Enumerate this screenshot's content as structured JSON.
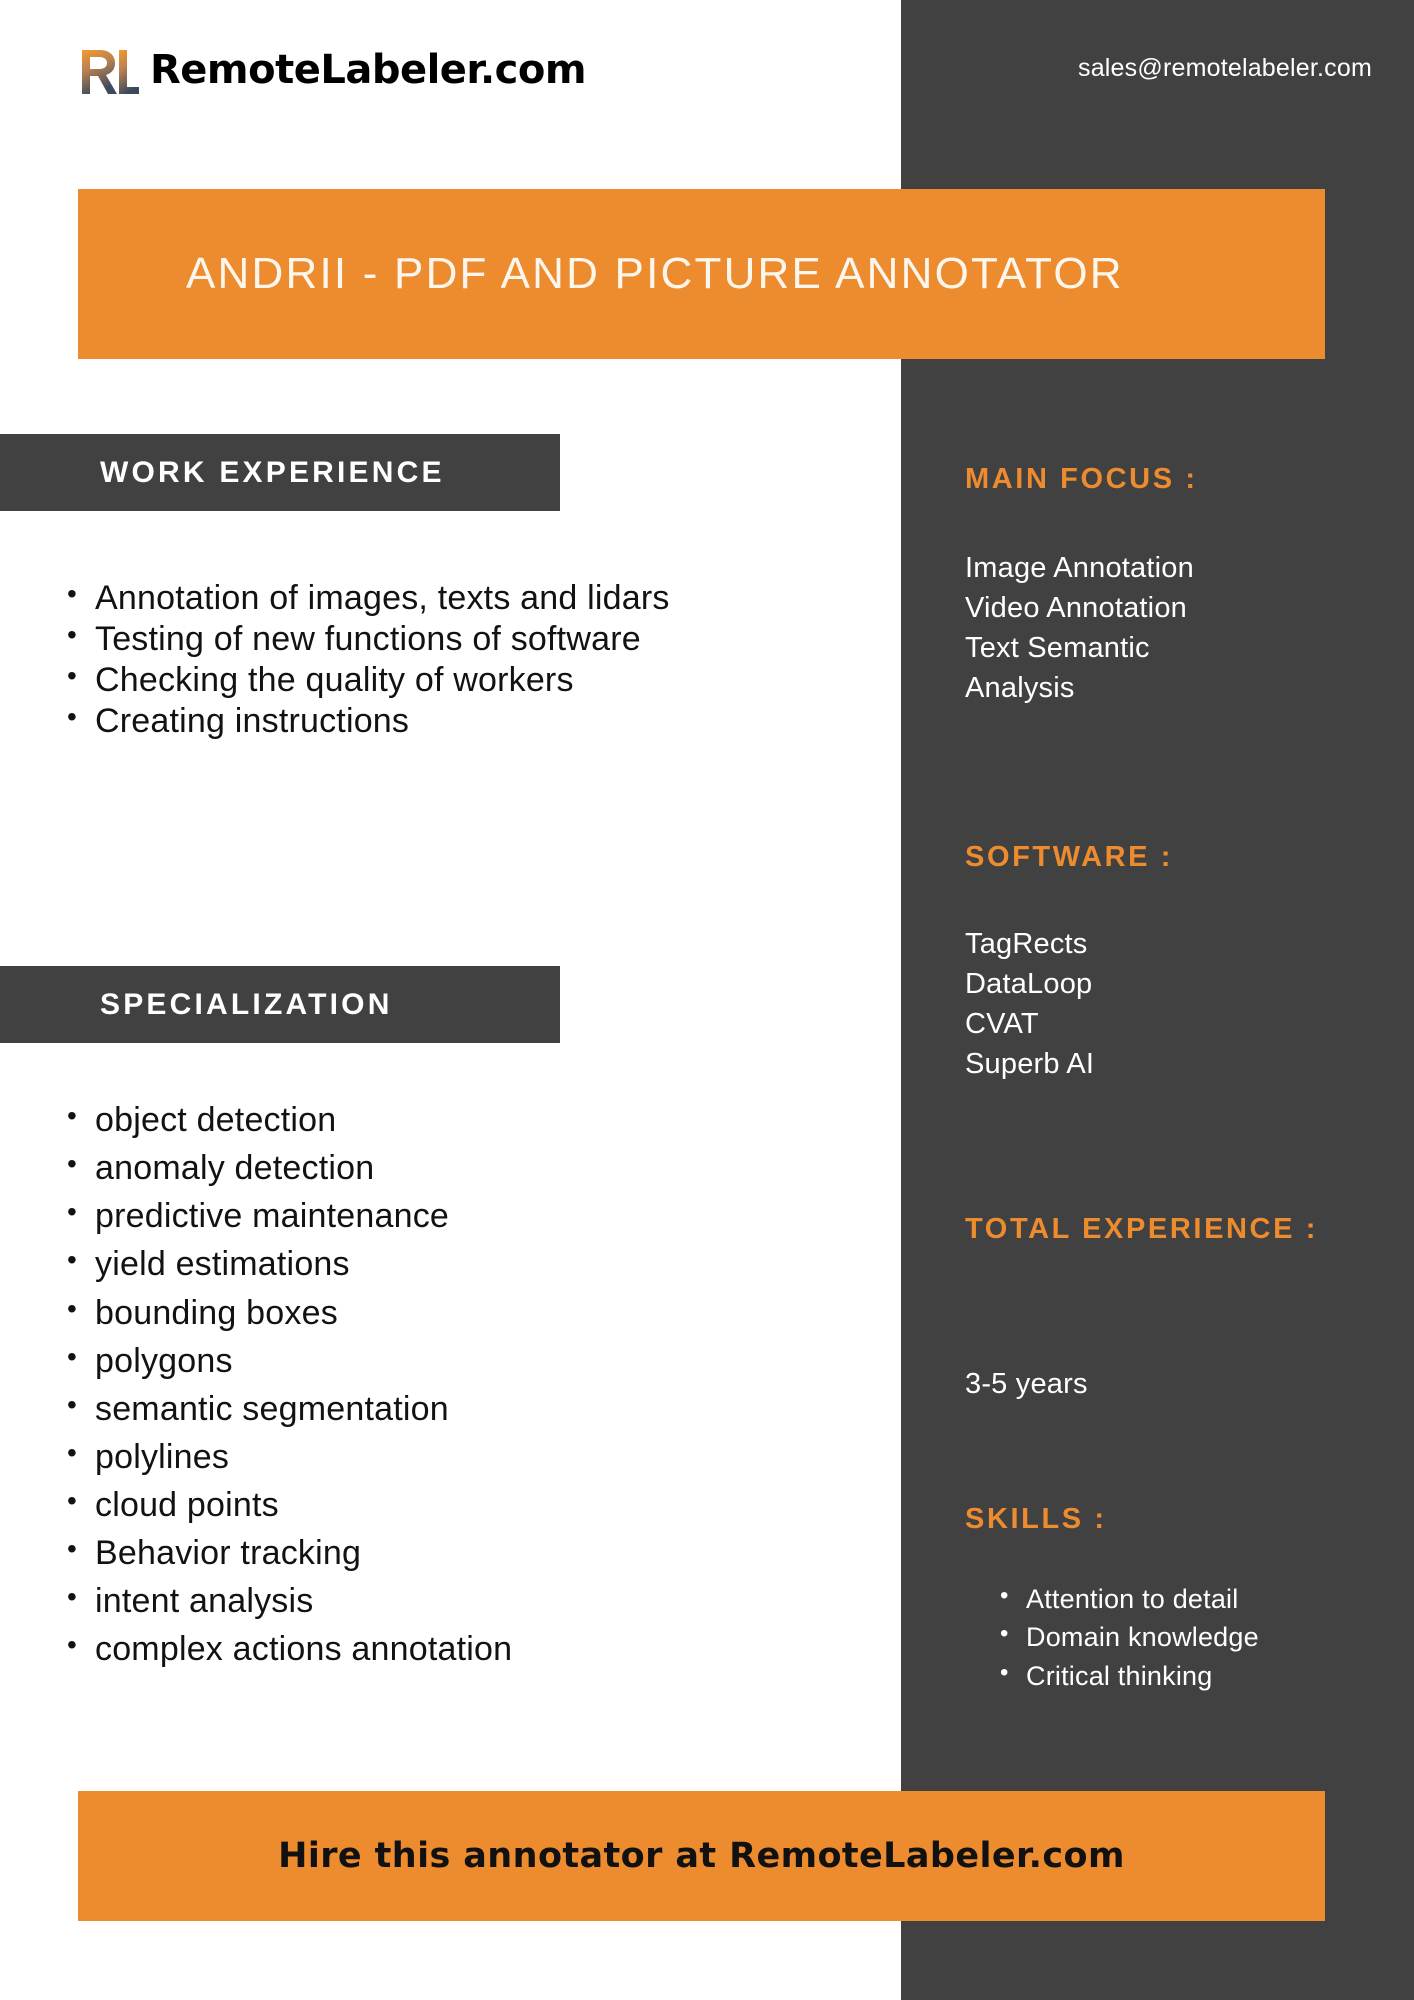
{
  "header": {
    "logo_icon": "rl-monogram-icon",
    "brand_name": "RemoteLabeler.com",
    "email": "sales@remotelabeler.com"
  },
  "title_banner": {
    "title": "ANDRII - PDF AND PICTURE ANNOTATOR"
  },
  "left_column": {
    "work_experience": {
      "heading": "WORK EXPERIENCE",
      "items": [
        "Annotation of images, texts and lidars",
        "Testing of new functions of software",
        "Checking the quality of workers",
        "Creating instructions"
      ]
    },
    "specialization": {
      "heading": "SPECIALIZATION",
      "items": [
        "object detection",
        "anomaly detection",
        "predictive maintenance",
        "yield estimations",
        "bounding boxes",
        "polygons",
        "semantic segmentation",
        "polylines",
        "cloud points",
        "Behavior tracking",
        "intent analysis",
        "complex actions annotation"
      ]
    }
  },
  "right_column": {
    "main_focus": {
      "heading": "MAIN FOCUS :",
      "items": [
        "Image Annotation",
        "Video Annotation",
        "Text Semantic",
        "Analysis"
      ]
    },
    "software": {
      "heading": "SOFTWARE :",
      "items": [
        "TagRects",
        "DataLoop",
        "CVAT",
        "Superb AI"
      ]
    },
    "total_experience": {
      "heading": "TOTAL EXPERIENCE :",
      "value": "3-5 years"
    },
    "skills": {
      "heading": "SKILLS :",
      "items": [
        "Attention to detail",
        "Domain knowledge",
        "Critical thinking"
      ]
    }
  },
  "cta": {
    "text": "Hire this annotator at RemoteLabeler.com"
  },
  "colors": {
    "accent_orange": "#ED8B2F",
    "dark_charcoal": "#414141",
    "title_cream": "#FDF6EC",
    "body_black": "#121212",
    "white": "#FFFFFF"
  }
}
